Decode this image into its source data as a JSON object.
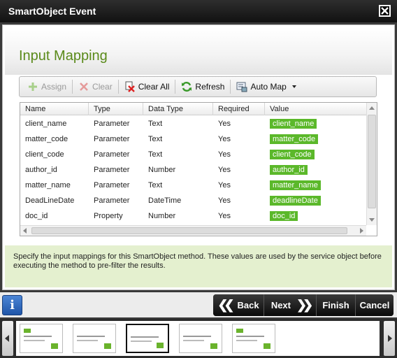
{
  "window": {
    "title": "SmartObject Event"
  },
  "page": {
    "title": "Input Mapping"
  },
  "toolbar": {
    "assign": "Assign",
    "clear": "Clear",
    "clear_all": "Clear All",
    "refresh": "Refresh",
    "auto_map": "Auto Map"
  },
  "grid": {
    "headers": {
      "name": "Name",
      "type": "Type",
      "data_type": "Data Type",
      "required": "Required",
      "value": "Value"
    },
    "rows": [
      {
        "name": "client_name",
        "type": "Parameter",
        "data_type": "Text",
        "required": "Yes",
        "value": "client_name"
      },
      {
        "name": "matter_code",
        "type": "Parameter",
        "data_type": "Text",
        "required": "Yes",
        "value": "matter_code"
      },
      {
        "name": "client_code",
        "type": "Parameter",
        "data_type": "Text",
        "required": "Yes",
        "value": "client_code"
      },
      {
        "name": "author_id",
        "type": "Parameter",
        "data_type": "Number",
        "required": "Yes",
        "value": "author_id"
      },
      {
        "name": "matter_name",
        "type": "Parameter",
        "data_type": "Text",
        "required": "Yes",
        "value": "matter_name"
      },
      {
        "name": "DeadLineDate",
        "type": "Parameter",
        "data_type": "DateTime",
        "required": "Yes",
        "value": "deadlineDate"
      },
      {
        "name": "doc_id",
        "type": "Property",
        "data_type": "Number",
        "required": "Yes",
        "value": "doc_id"
      }
    ]
  },
  "description": "Specify the input mappings for this SmartObject method. These values are used by the service object before executing the method to pre-filter the results.",
  "nav": {
    "info": "i",
    "back": "Back",
    "next": "Next",
    "finish": "Finish",
    "cancel": "Cancel"
  },
  "colors": {
    "accent_green": "#5bb82a",
    "title_green": "#5a8a1a",
    "description_bg": "#e4f0cf"
  }
}
